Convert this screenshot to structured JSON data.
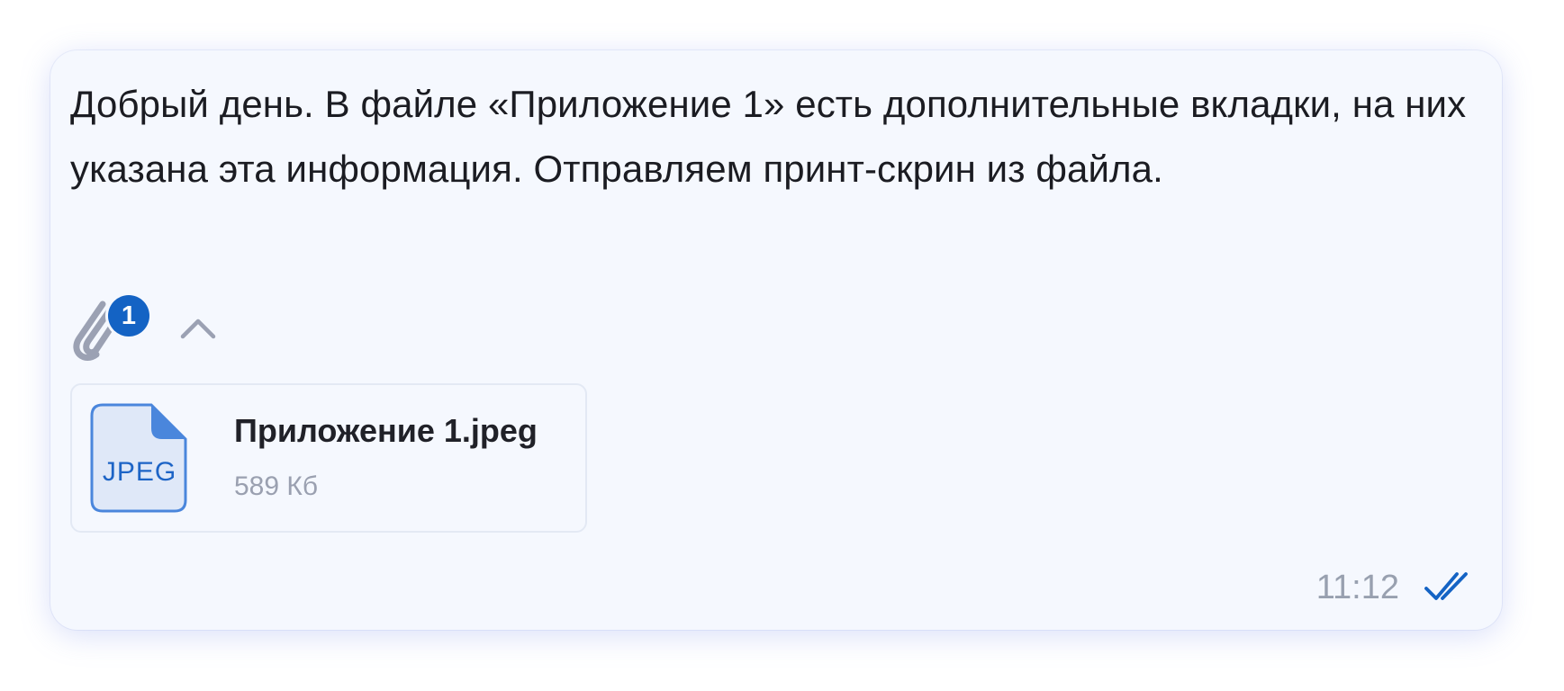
{
  "message": {
    "text": "Добрый день. В файле «Приложение 1» есть дополнительные вкладки, на них указана эта информация. Отправляем принт-скрин из файла.",
    "time": "11:12",
    "status": "read",
    "status_icon": "double-check-icon"
  },
  "attachments": {
    "count": "1",
    "toggle_icon": "chevron-up-icon",
    "clip_icon": "paperclip-icon",
    "files": [
      {
        "name": "Приложение 1.jpeg",
        "size": "589 Кб",
        "type_label": "JPEG",
        "icon": "jpeg-file-icon"
      }
    ]
  },
  "colors": {
    "bubble_background": "#f5f8fe",
    "accent": "#1463c4",
    "text": "#1b1c22",
    "muted": "#98a0af"
  }
}
